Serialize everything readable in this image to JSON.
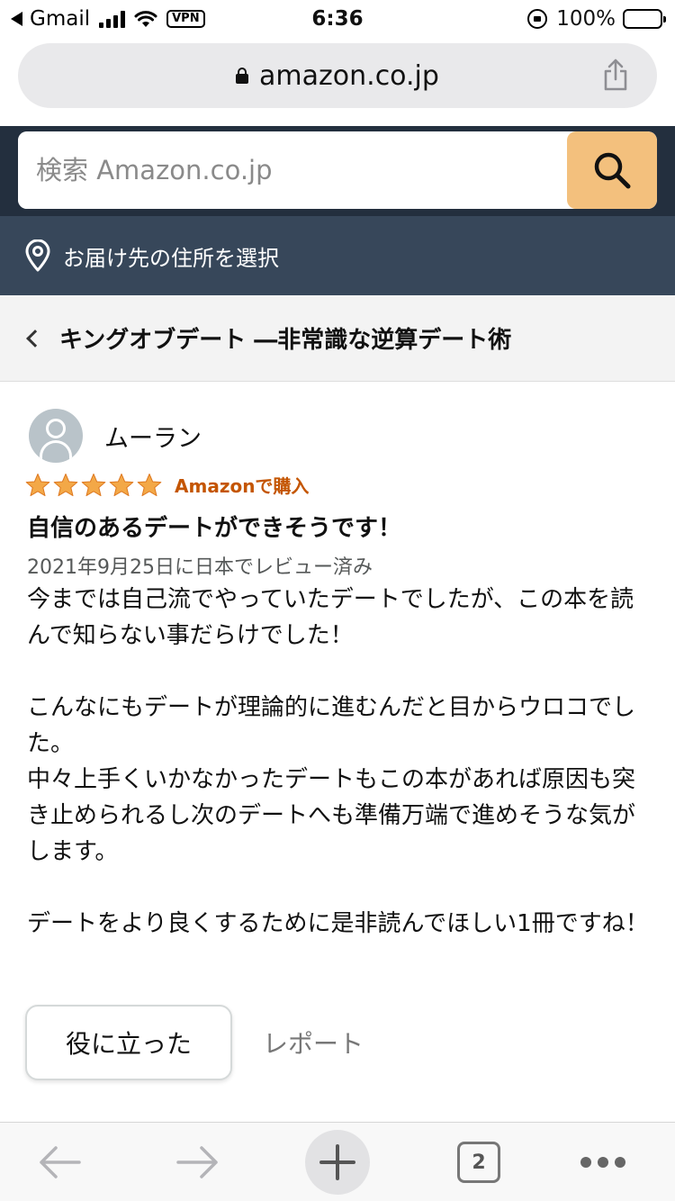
{
  "status_bar": {
    "back_app": "Gmail",
    "vpn": "VPN",
    "time": "6:36",
    "battery": "100%"
  },
  "url_bar": {
    "url": "amazon.co.jp",
    "icons": [
      "lock-icon",
      "share-icon"
    ]
  },
  "search": {
    "placeholder": "検索 Amazon.co.jp",
    "button_icon": "search-icon",
    "accent_color": "#f3c07d"
  },
  "delivery": {
    "label": "お届け先の住所を選択",
    "icon": "location-pin-icon"
  },
  "product": {
    "title": "キングオブデート ―非常識な逆算デート術"
  },
  "review": {
    "reviewer_name": "ムーラン",
    "rating": 5,
    "rating_max": 5,
    "star_color": "#f3a847",
    "verified_label": "Amazonで購入",
    "title": "自信のあるデートができそうです！",
    "date": "2021年9月25日に日本でレビュー済み",
    "body": "今までは自己流でやっていたデートでしたが、この本を読んで知らない事だらけでした！\n\nこんなにもデートが理論的に進むんだと目からウロコでした。\n中々上手くいかなかったデートもこの本があれば原因も突き止められるし次のデートへも準備万端で進めそうな気がします。\n\nデートをより良くするために是非読んでほしい1冊ですね！",
    "helpful_label": "役に立った",
    "report_label": "レポート"
  },
  "toolbar": {
    "tab_count": "2",
    "icons": [
      "back-arrow-icon",
      "forward-arrow-icon",
      "new-tab-plus-icon",
      "tabs-icon",
      "more-icon"
    ]
  },
  "colors": {
    "header_dark": "#232f3e",
    "deliver_bar": "#37475a",
    "verified": "#c45500"
  }
}
